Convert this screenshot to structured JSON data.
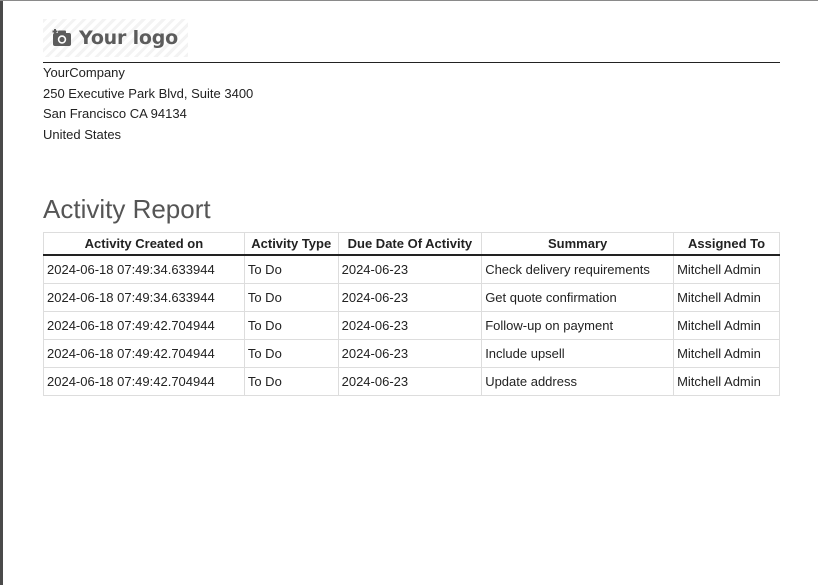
{
  "logo": {
    "text": "Your logo",
    "icon": "camera-icon"
  },
  "company": {
    "name": "YourCompany",
    "street": "250 Executive Park Blvd, Suite 3400",
    "city_line": "San Francisco CA 94134",
    "country": "United States"
  },
  "report": {
    "title": "Activity Report",
    "columns": [
      "Activity Created on",
      "Activity Type",
      "Due Date Of Activity",
      "Summary",
      "Assigned To"
    ],
    "rows": [
      [
        "2024-06-18 07:49:34.633944",
        "To Do",
        "2024-06-23",
        "Check delivery requirements",
        "Mitchell Admin"
      ],
      [
        "2024-06-18 07:49:34.633944",
        "To Do",
        "2024-06-23",
        "Get quote confirmation",
        "Mitchell Admin"
      ],
      [
        "2024-06-18 07:49:42.704944",
        "To Do",
        "2024-06-23",
        "Follow-up on payment",
        "Mitchell Admin"
      ],
      [
        "2024-06-18 07:49:42.704944",
        "To Do",
        "2024-06-23",
        "Include upsell",
        "Mitchell Admin"
      ],
      [
        "2024-06-18 07:49:42.704944",
        "To Do",
        "2024-06-23",
        "Update address",
        "Mitchell Admin"
      ]
    ]
  }
}
